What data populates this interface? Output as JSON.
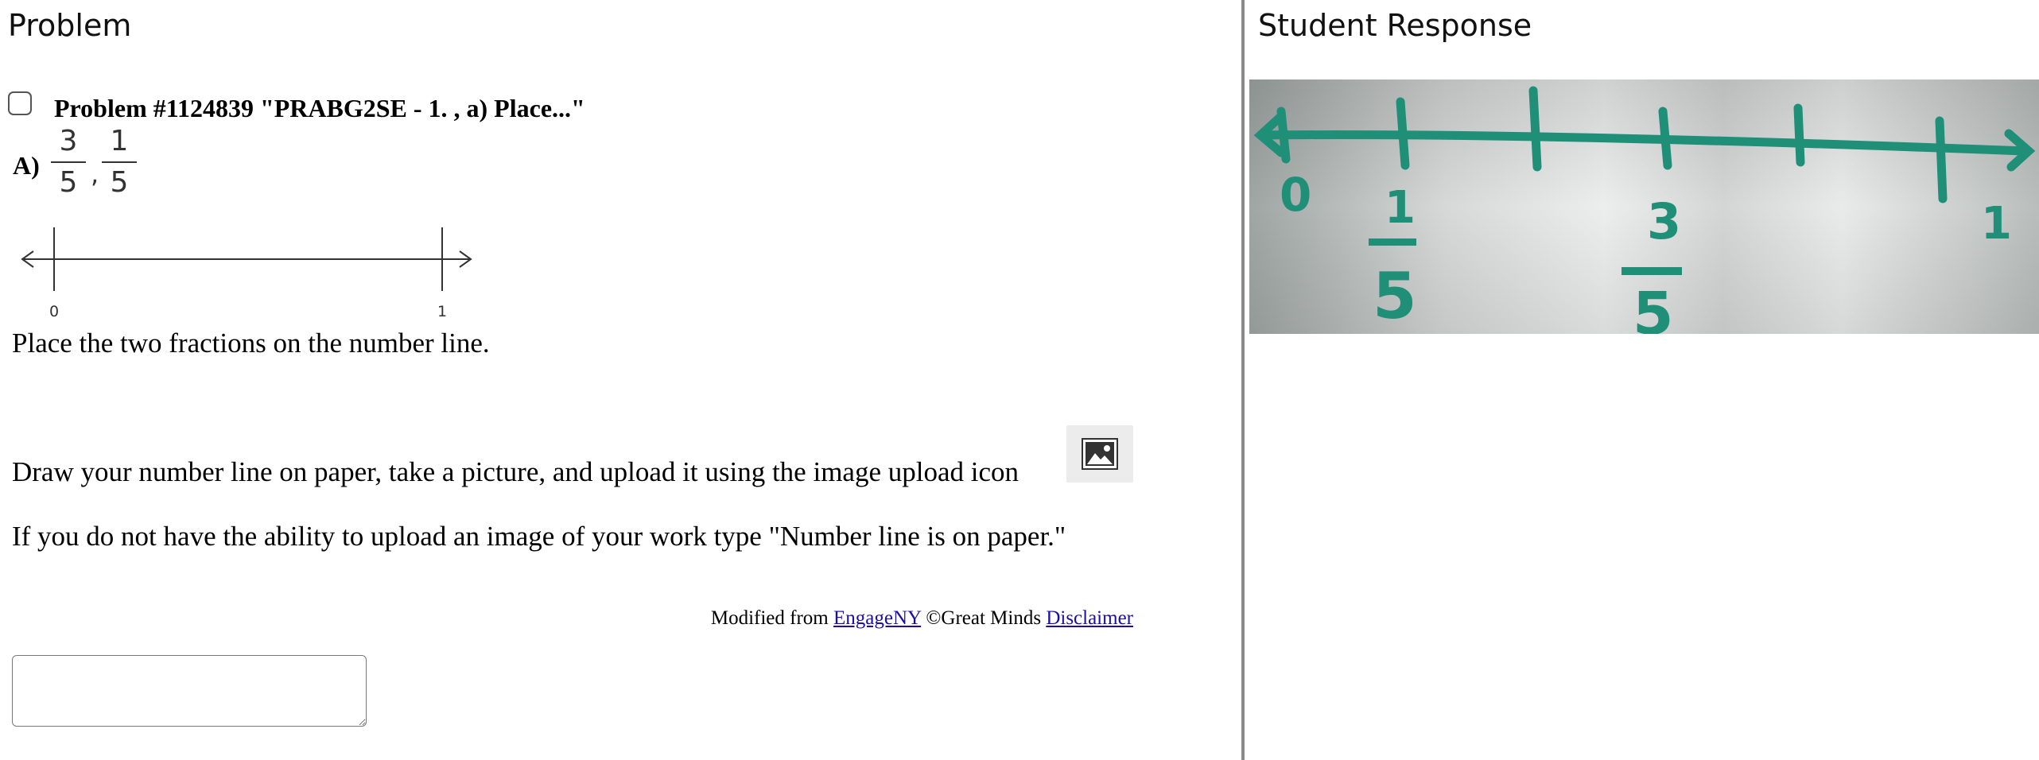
{
  "left_panel": {
    "title": "Problem",
    "problem_header": "Problem #1124839 \"PRABG2SE - 1. , a) Place...\"",
    "answer_letter": "A)",
    "fractions": [
      {
        "numerator": "3",
        "denominator": "5"
      },
      {
        "numerator": "1",
        "denominator": "5"
      }
    ],
    "fraction_separator": ",",
    "number_line": {
      "start_label": "0",
      "end_label": "1"
    },
    "instruction": "Place the two fractions on the number line.",
    "upload_instruction": "Draw your number line on paper, take a picture, and upload it using the image upload icon",
    "upload_icon": "image-upload-icon",
    "paper_instruction": "If you do not have the ability to upload an image of your work type \"Number line is on paper.\"",
    "credits": {
      "prefix": "Modified from",
      "engageny_link": "EngageNY",
      "copyright": "©Great Minds",
      "disclaimer_link": "Disclaimer"
    },
    "answer_value": ""
  },
  "right_panel": {
    "title": "Student Response",
    "photo_labels": {
      "zero": "0",
      "first_fraction_num": "1",
      "first_fraction_den": "5",
      "second_fraction_num": "3",
      "second_fraction_den": "5",
      "one": "1"
    }
  },
  "colors": {
    "link": "#1a0dab",
    "divider": "#8a8a8a",
    "ink_marker": "#1f8f78",
    "whiteboard": "#dcdedd"
  }
}
